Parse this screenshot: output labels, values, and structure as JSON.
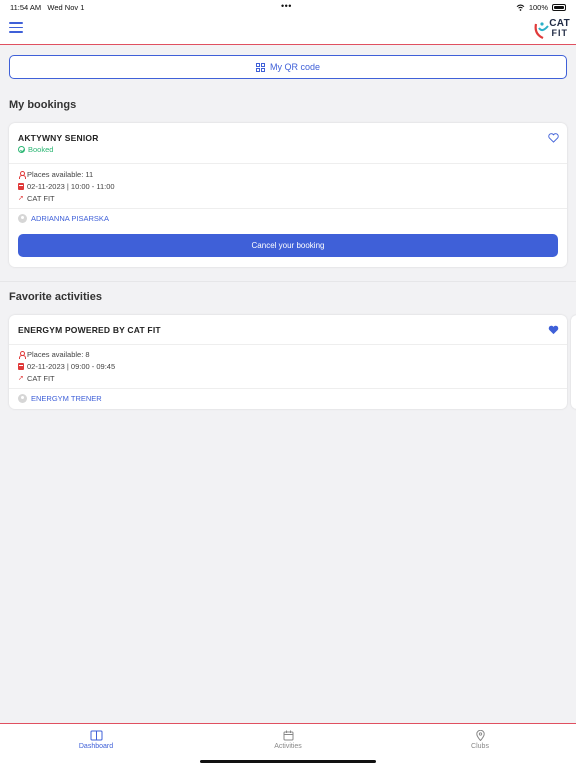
{
  "status_bar": {
    "time": "11:54 AM",
    "date": "Wed Nov 1",
    "battery": "100%"
  },
  "header": {
    "logo_text_top": "CAT",
    "logo_text_bottom": "FIT"
  },
  "qr_button": {
    "label": "My QR code"
  },
  "bookings": {
    "title": "My bookings",
    "card": {
      "name": "AKTYWNY SENIOR",
      "status": "Booked",
      "places": "Places available: 11",
      "datetime": "02-11-2023 | 10:00 - 11:00",
      "club": "CAT FIT",
      "trainer": "ADRIANNA PISARSKA",
      "cancel_label": "Cancel your booking"
    }
  },
  "favorites": {
    "title": "Favorite activities",
    "card": {
      "name": "ENERGYM POWERED BY CAT FIT",
      "places": "Places available: 8",
      "datetime": "02-11-2023 | 09:00 - 09:45",
      "club": "CAT FIT",
      "trainer": "ENERGYM TRENER"
    }
  },
  "tabs": [
    {
      "label": "Dashboard",
      "icon": "book-icon",
      "active": true
    },
    {
      "label": "Activities",
      "icon": "calendar-icon",
      "active": false
    },
    {
      "label": "Clubs",
      "icon": "map-pin-icon",
      "active": false
    }
  ],
  "colors": {
    "accent": "#3f60d8",
    "booked": "#2bb673",
    "icon_red": "#e03a3a",
    "header_line": "#e05060"
  }
}
